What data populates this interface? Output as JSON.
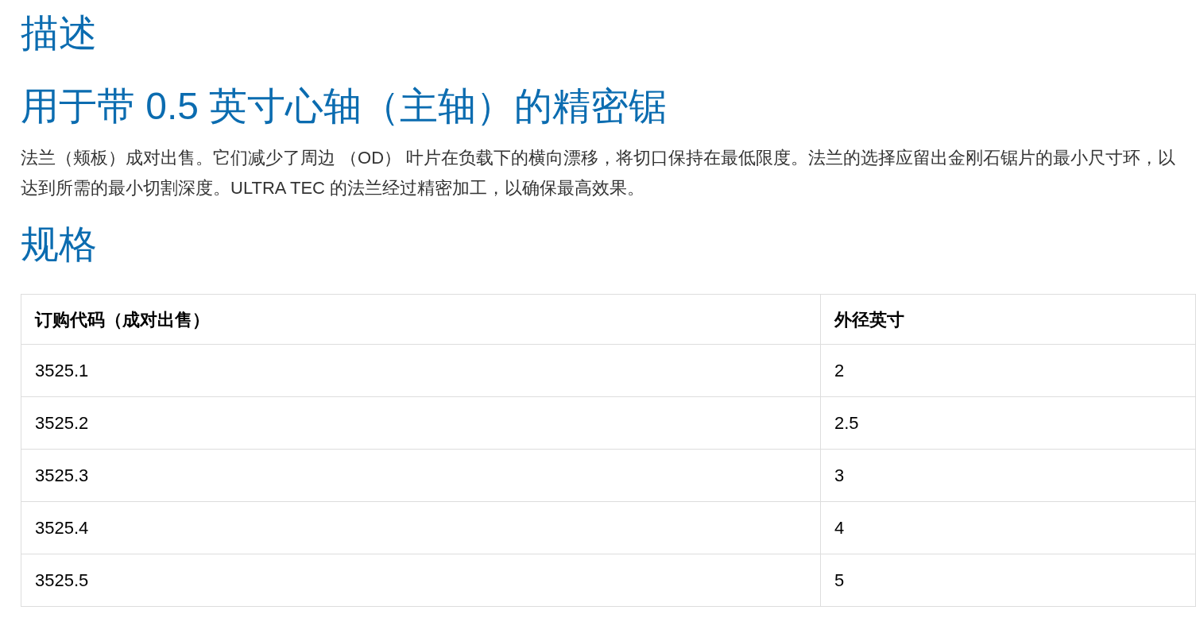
{
  "description_heading": "描述",
  "product_title": "用于带 0.5 英寸心轴（主轴）的精密锯",
  "description": "法兰（颊板）成对出售。它们减少了周边 （OD） 叶片在负载下的横向漂移，将切口保持在最低限度。法兰的选择应留出金刚石锯片的最小尺寸环，以达到所需的最小切割深度。ULTRA TEC 的法兰经过精密加工，以确保最高效果。",
  "specs_heading": "规格",
  "table": {
    "columns": [
      "订购代码（成对出售）",
      "外径英寸"
    ],
    "rows": [
      [
        "3525.1",
        "2"
      ],
      [
        "3525.2",
        "2.5"
      ],
      [
        "3525.3",
        "3"
      ],
      [
        "3525.4",
        "4"
      ],
      [
        "3525.5",
        "5"
      ]
    ]
  }
}
